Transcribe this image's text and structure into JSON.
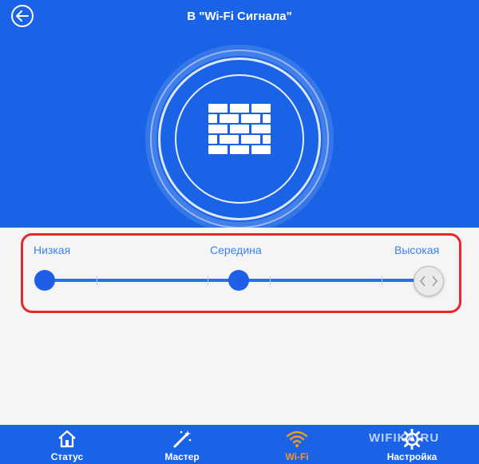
{
  "header": {
    "title": "В \"Wi-Fi Сигнала\"",
    "back_icon": "arrow-left-icon",
    "center_icon": "brick-wall-icon"
  },
  "signal_levels": {
    "low": "Низкая",
    "mid": "Середина",
    "high": "Высокая",
    "selected": "Высокая"
  },
  "nav": {
    "items": [
      {
        "label": "Статус",
        "icon": "house-icon"
      },
      {
        "label": "Мастер",
        "icon": "magic-wand-icon"
      },
      {
        "label": "Wi-Fi",
        "icon": "wifi-icon"
      },
      {
        "label": "Настройка",
        "icon": "gear-icon"
      }
    ],
    "active": "Wi-Fi"
  },
  "watermark": "WIFIKA.RU",
  "colors": {
    "primary": "#1a63e6",
    "accent": "#f39a1e",
    "highlight": "#e8262b",
    "label": "#3b82f0"
  }
}
